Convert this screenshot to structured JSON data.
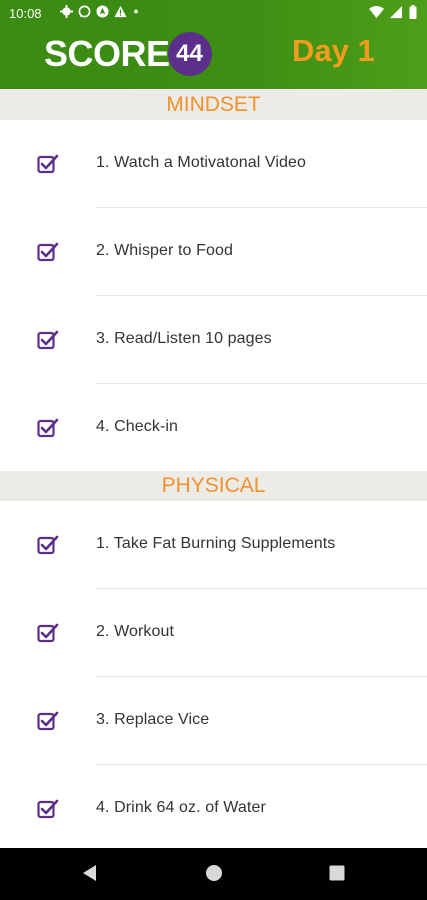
{
  "status_bar": {
    "time": "10:08",
    "left_icons": [
      "settings-icon",
      "whatsapp-icon",
      "navigation-icon",
      "alert-icon",
      "dot-icon"
    ],
    "right_icons": [
      "wifi-icon",
      "signal-icon",
      "battery-icon"
    ]
  },
  "header": {
    "logo_text": "SCORE",
    "logo_badge": "44",
    "day_label": "Day 1",
    "colors": {
      "background": "#3e8f14",
      "day": "#f39c1e",
      "badge": "#5b2f8a"
    }
  },
  "sections": [
    {
      "title": "MINDSET",
      "items": [
        {
          "label": "1. Watch a Motivatonal Video",
          "checked": true
        },
        {
          "label": "2. Whisper to Food",
          "checked": true
        },
        {
          "label": "3. Read/Listen 10 pages",
          "checked": true
        },
        {
          "label": "4. Check-in",
          "checked": true
        }
      ]
    },
    {
      "title": "PHYSICAL",
      "items": [
        {
          "label": "1. Take Fat Burning Supplements",
          "checked": true
        },
        {
          "label": "2. Workout",
          "checked": true
        },
        {
          "label": "3. Replace Vice",
          "checked": true
        },
        {
          "label": "4. Drink 64 oz. of Water",
          "checked": true
        }
      ]
    }
  ],
  "colors": {
    "section_title": "#f0922e",
    "checkbox": "#5b2f8a"
  },
  "nav_bar": {
    "buttons": [
      "back-icon",
      "home-icon",
      "recents-icon"
    ]
  }
}
